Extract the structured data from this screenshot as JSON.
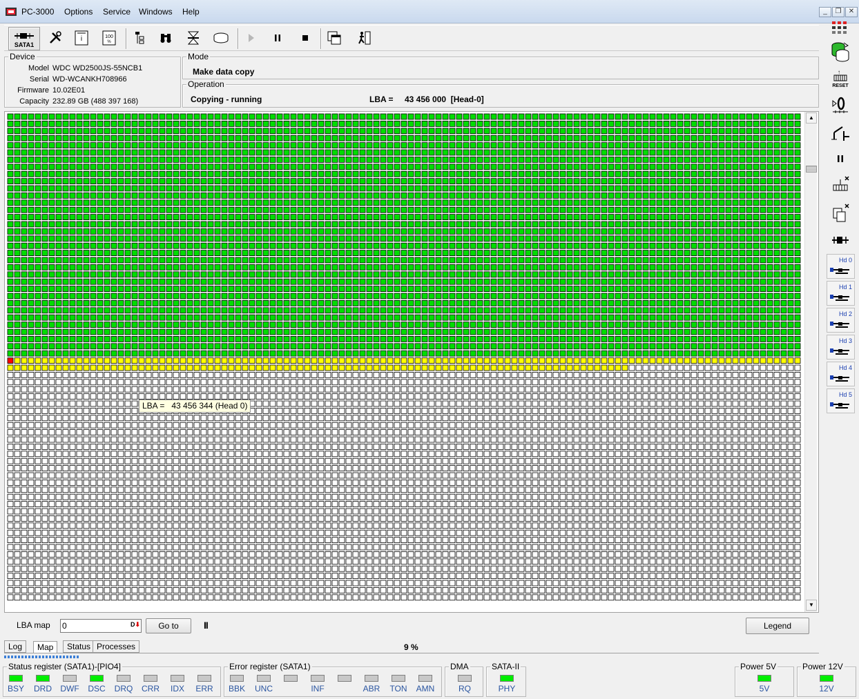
{
  "window": {
    "title": "PC-3000",
    "menu": [
      "Options",
      "Service",
      "Windows",
      "Help"
    ],
    "controls": [
      "_",
      "❐",
      "✕"
    ]
  },
  "toolbar": {
    "interface_label": "SATA1",
    "icons": [
      "interface-icon",
      "tools-icon",
      "drive-id-icon",
      "smart-icon",
      "tree-icon",
      "binoculars-icon",
      "head-map-icon",
      "disk-icon",
      "play-icon",
      "pause-icon",
      "stop-icon",
      "copy-window-icon",
      "exit-icon"
    ]
  },
  "device": {
    "group_title": "Device",
    "rows": [
      {
        "label": "Model",
        "value": "WDC WD2500JS-55NCB1"
      },
      {
        "label": "Serial",
        "value": "WD-WCANKH708966"
      },
      {
        "label": "Firmware",
        "value": "10.02E01"
      },
      {
        "label": "Capacity",
        "value": "232.89 GB (488 397 168)"
      }
    ]
  },
  "mode": {
    "group_title": "Mode",
    "value": "Make data copy"
  },
  "operation": {
    "group_title": "Operation",
    "status": "Copying - running",
    "lba_label": "LBA =",
    "lba_value": "43 456 000  [Head-0]"
  },
  "map": {
    "green_rows": 34,
    "total_rows": 68,
    "cols": 115,
    "yellow_row_cells": 115,
    "yellow_row2_cells": 90,
    "error_cell": {
      "row": 34,
      "col": 0
    },
    "colors": {
      "done": "#00dd00",
      "in_progress": "#ffff00",
      "pending": "#ffffff",
      "error": "#ff0000",
      "grid": "#000000"
    },
    "tooltip": "LBA =   43 456 344 (Head 0)"
  },
  "lba_map": {
    "label": "LBA map",
    "input_value": "0",
    "goto_label": "Go to",
    "pause_label": "II",
    "legend_label": "Legend"
  },
  "tabs": [
    "Log",
    "Map",
    "Status",
    "Processes"
  ],
  "progress": "9 %",
  "status_register": {
    "title": "Status register (SATA1)-[PIO4]",
    "bits": [
      {
        "name": "BSY",
        "on": true
      },
      {
        "name": "DRD",
        "on": true
      },
      {
        "name": "DWF",
        "on": false
      },
      {
        "name": "DSC",
        "on": true
      },
      {
        "name": "DRQ",
        "on": false
      },
      {
        "name": "CRR",
        "on": false
      },
      {
        "name": "IDX",
        "on": false
      },
      {
        "name": "ERR",
        "on": false
      }
    ]
  },
  "error_register": {
    "title": "Error register (SATA1)",
    "bits": [
      {
        "name": "BBK",
        "on": false
      },
      {
        "name": "UNC",
        "on": false
      },
      {
        "name": "",
        "on": false
      },
      {
        "name": "INF",
        "on": false
      },
      {
        "name": "",
        "on": false
      },
      {
        "name": "ABR",
        "on": false
      },
      {
        "name": "TON",
        "on": false
      },
      {
        "name": "AMN",
        "on": false
      }
    ]
  },
  "dma": {
    "title": "DMA",
    "bit": "RQ",
    "on": false
  },
  "sata2": {
    "title": "SATA-II",
    "bit": "PHY",
    "on": true
  },
  "power5": {
    "title": "Power 5V",
    "bit": "5V",
    "on": true
  },
  "power12": {
    "title": "Power 12V",
    "bit": "12V",
    "on": true
  },
  "sidebar": {
    "icons": [
      "drives-grid-icon",
      "database-icon",
      "reset-icon",
      "power-cycle-icon",
      "switch-icon",
      "pause-icon",
      "sector-icon",
      "copy-icon",
      "connector-icon"
    ],
    "reset_label": "RESET",
    "heads": [
      "Hd 0",
      "Hd 1",
      "Hd 2",
      "Hd 3",
      "Hd 4",
      "Hd 5"
    ]
  }
}
